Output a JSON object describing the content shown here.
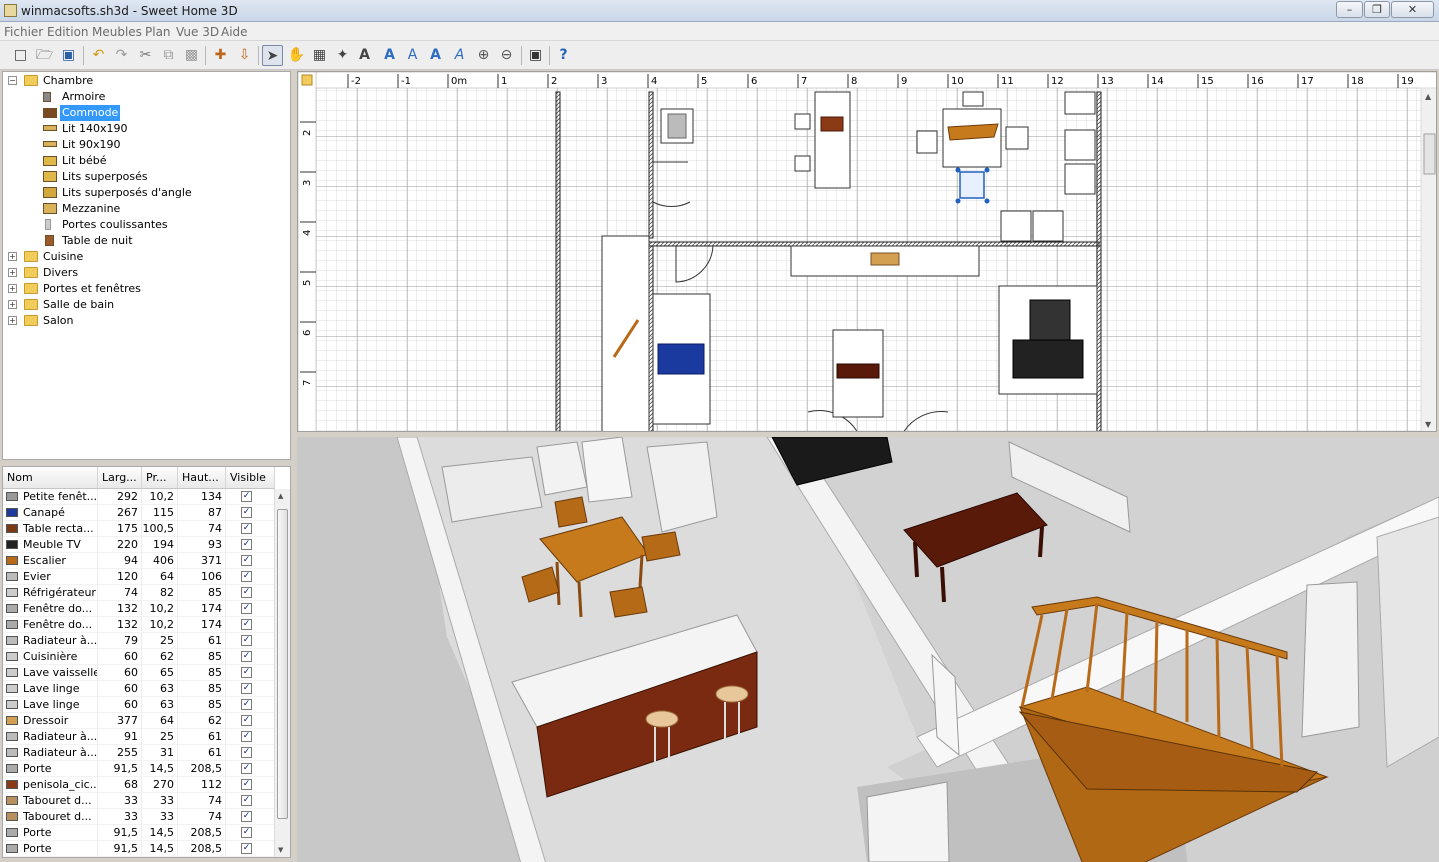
{
  "window": {
    "title": "winmacsofts.sh3d - Sweet Home 3D",
    "minimize": "–",
    "maximize": "❐",
    "close": "✕"
  },
  "menu": [
    "Fichier",
    "Edition",
    "Meubles",
    "Plan",
    "Vue 3D",
    "Aide"
  ],
  "toolbar": {
    "icons": [
      "new-icon",
      "open-icon",
      "save-icon",
      "undo-icon",
      "redo-icon",
      "cut-icon",
      "copy-icon",
      "paste-icon",
      "add-furniture-icon",
      "import-furniture-icon",
      "select-mode-icon",
      "pan-mode-icon",
      "create-walls-icon",
      "create-rooms-icon",
      "create-text-icon",
      "increase-text-icon",
      "decrease-text-icon",
      "bold-text-icon",
      "italic-text-icon",
      "zoom-in-icon",
      "zoom-out-icon",
      "create-photo-icon",
      "help-icon"
    ]
  },
  "catalog": {
    "categories": [
      {
        "label": "Chambre",
        "expanded": true,
        "items": [
          "Armoire",
          "Commode",
          "Lit 140x190",
          "Lit 90x190",
          "Lit bébé",
          "Lits superposés",
          "Lits superposés d'angle",
          "Mezzanine",
          "Portes coulissantes",
          "Table de nuit"
        ],
        "selected": "Commode"
      },
      {
        "label": "Cuisine",
        "expanded": false
      },
      {
        "label": "Divers",
        "expanded": false
      },
      {
        "label": "Portes et fenêtres",
        "expanded": false
      },
      {
        "label": "Salle de bain",
        "expanded": false
      },
      {
        "label": "Salon",
        "expanded": false
      }
    ]
  },
  "furniture_table": {
    "columns": [
      "Nom",
      "Larg...",
      "Pr...",
      "Haut...",
      "Visible"
    ],
    "rows": [
      [
        "Petite fenêt...",
        "292",
        "10,2",
        "134"
      ],
      [
        "Canapé",
        "267",
        "115",
        "87"
      ],
      [
        "Table recta...",
        "175",
        "100,5",
        "74"
      ],
      [
        "Meuble TV",
        "220",
        "194",
        "93"
      ],
      [
        "Escalier",
        "94",
        "406",
        "371"
      ],
      [
        "Evier",
        "120",
        "64",
        "106"
      ],
      [
        "Réfrigérateur",
        "74",
        "82",
        "85"
      ],
      [
        "Fenêtre do...",
        "132",
        "10,2",
        "174"
      ],
      [
        "Fenêtre do...",
        "132",
        "10,2",
        "174"
      ],
      [
        "Radiateur à...",
        "79",
        "25",
        "61"
      ],
      [
        "Cuisinière",
        "60",
        "62",
        "85"
      ],
      [
        "Lave vaisselle",
        "60",
        "65",
        "85"
      ],
      [
        "Lave linge",
        "60",
        "63",
        "85"
      ],
      [
        "Lave linge",
        "60",
        "63",
        "85"
      ],
      [
        "Dressoir",
        "377",
        "64",
        "62"
      ],
      [
        "Radiateur à...",
        "91",
        "25",
        "61"
      ],
      [
        "Radiateur à...",
        "255",
        "31",
        "61"
      ],
      [
        "Porte",
        "91,5",
        "14,5",
        "208,5"
      ],
      [
        "penisola_cic...",
        "68",
        "270",
        "112"
      ],
      [
        "Tabouret d...",
        "33",
        "33",
        "74"
      ],
      [
        "Tabouret d...",
        "33",
        "33",
        "74"
      ],
      [
        "Porte",
        "91,5",
        "14,5",
        "208,5"
      ],
      [
        "Porte",
        "91,5",
        "14,5",
        "208,5"
      ]
    ],
    "check": "✓"
  },
  "plan": {
    "ruler_x": [
      "-2",
      "-1",
      "0m",
      "1",
      "2",
      "3",
      "4",
      "5",
      "6",
      "7",
      "8",
      "9",
      "10",
      "11",
      "12",
      "13",
      "14",
      "15",
      "16",
      "17",
      "18",
      "19"
    ],
    "ruler_y": [
      "2",
      "3",
      "4",
      "5",
      "6",
      "7"
    ]
  },
  "colors": {
    "selection": "#3399ff",
    "wood": "#c67a1c",
    "floor": "#d9d9d9"
  }
}
